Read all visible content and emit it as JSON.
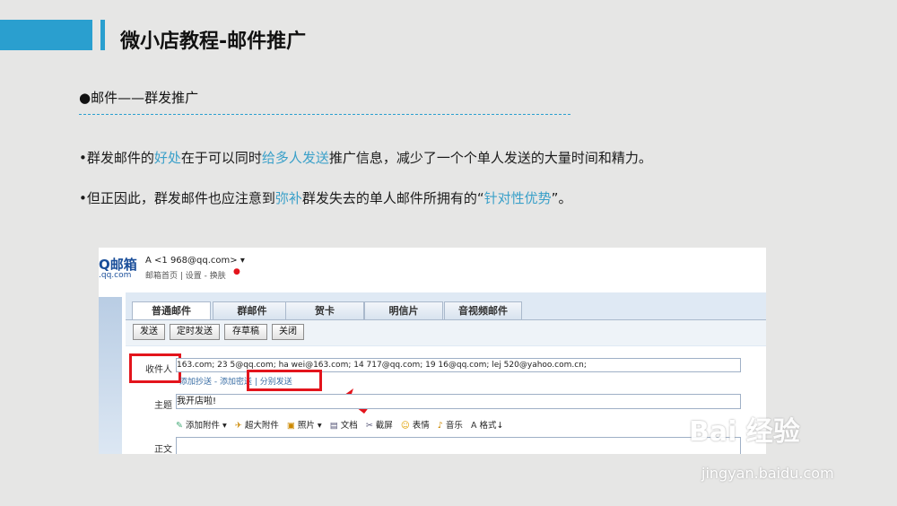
{
  "slide": {
    "title": "微小店教程-邮件推广",
    "section": "●邮件——群发推广",
    "para1": {
      "t1": "•群发邮件的",
      "h1": "好处",
      "t2": "在于可以同时",
      "h2": "给多人发送",
      "t3": "推广信息，减少了一个个单人发送的大量时间和精力。"
    },
    "para2": {
      "t1": "•但正因此，群发邮件也应注意到",
      "h1": "弥补",
      "t2": "群发失去的单人邮件所拥有的“",
      "h2": "针对性优势",
      "t3": "”。"
    }
  },
  "mail": {
    "logo": "Q邮箱",
    "logo_sub": ".qq.com",
    "account": "A <1   968@qq.com> ▾",
    "account_links": "邮箱首页 | 设置 - 换肤",
    "tabs": [
      "普通邮件",
      "群邮件",
      "贺卡",
      "明信片",
      "音视频邮件"
    ],
    "buttons": [
      "发送",
      "定时发送",
      "存草稿",
      "关闭"
    ],
    "to_label": "收件人",
    "recipients": "163.com;  23        5@qq.com;  ha        wei@163.com;  14        717@qq.com;  19        16@qq.com;  lej        520@yahoo.com.cn;",
    "cc_links": "添加抄送 - 添加密送 | 分别发送",
    "subject_label": "主题",
    "subject_value": "我开店啦!",
    "attach_items": [
      "添加附件",
      "超大附件",
      "照片",
      "文档",
      "截屏",
      "表情",
      "音乐",
      "格式"
    ],
    "body_label": "正文"
  },
  "watermark": {
    "brand": "Bai 经验",
    "url": "jingyan.baidu.com"
  },
  "colors": {
    "accent": "#2a9fcf",
    "highlight": "#3aa0c9",
    "annotation": "#e3141c"
  }
}
